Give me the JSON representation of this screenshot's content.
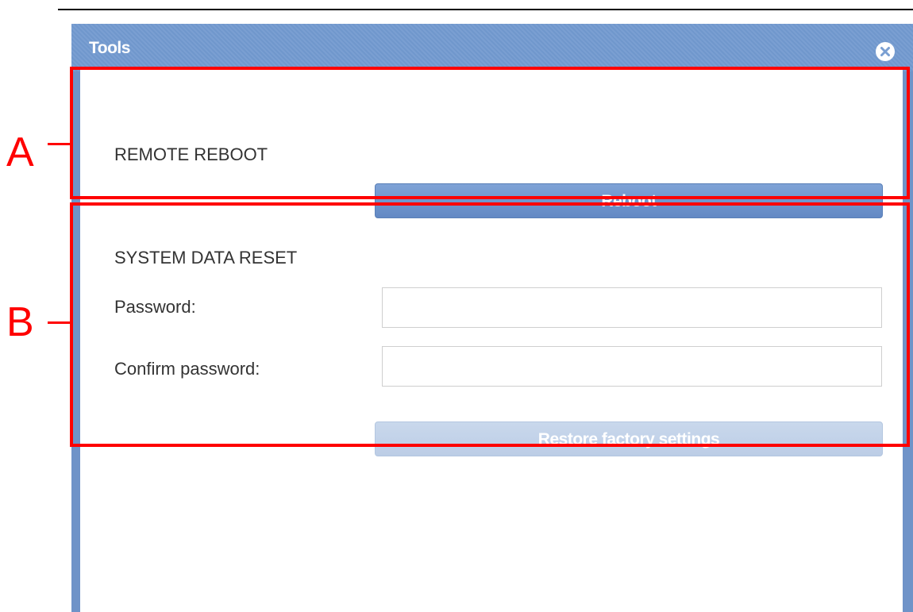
{
  "window": {
    "title": "Tools",
    "close_icon": "close-icon"
  },
  "remote_reboot": {
    "heading": "REMOTE REBOOT",
    "button_label": "Reboot"
  },
  "system_data_reset": {
    "heading": "SYSTEM DATA RESET",
    "password_label": "Password:",
    "password_value": "",
    "confirm_label": "Confirm password:",
    "confirm_value": "",
    "button_label": "Restore factory settings",
    "button_enabled": false
  },
  "annotations": {
    "a_label": "A",
    "b_label": "B",
    "color": "#ff0000"
  },
  "colors": {
    "titlebar": "#7097cc",
    "button_primary": "#6f94cc",
    "button_disabled": "#c3d3ea"
  }
}
